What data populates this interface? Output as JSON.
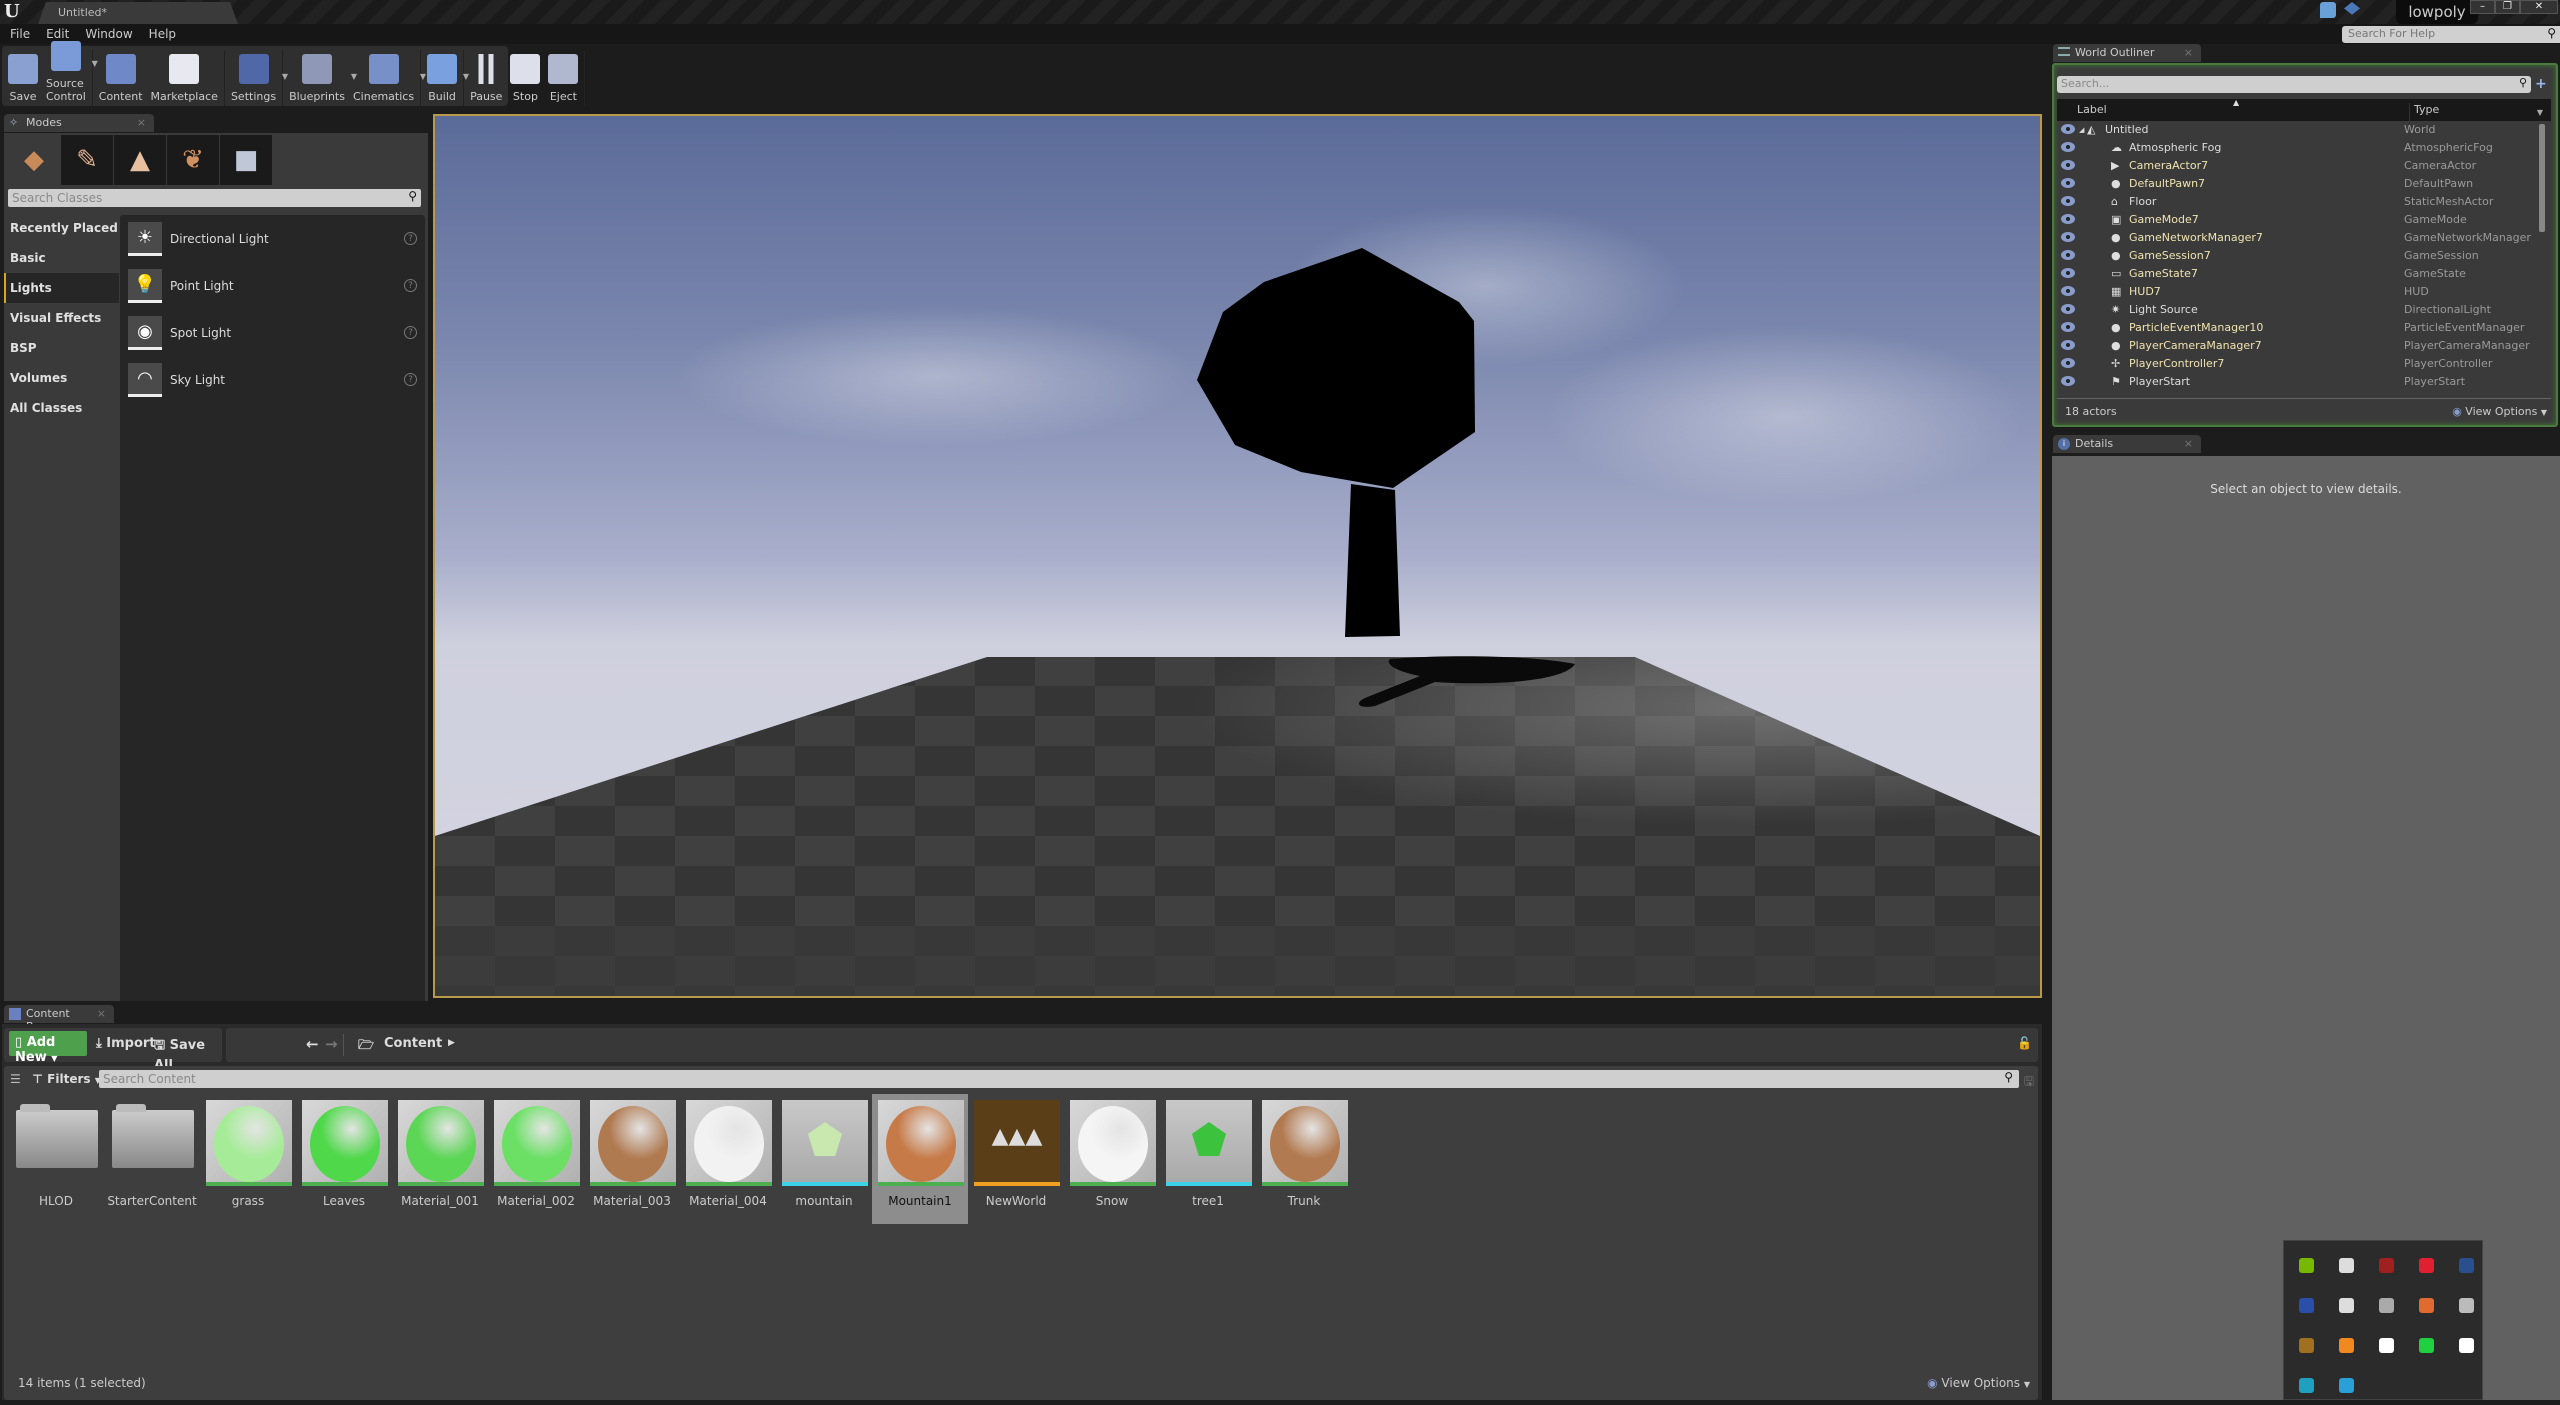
{
  "window": {
    "document_tab": "Untitled*",
    "project_name": "lowpoly",
    "help_search_placeholder": "Search For Help",
    "controls": {
      "minimize": "–",
      "restore": "❐",
      "close": "✕"
    }
  },
  "menu": [
    "File",
    "Edit",
    "Window",
    "Help"
  ],
  "toolbar": {
    "groups": [
      [
        {
          "label": "Save",
          "icon": "save-icon",
          "caret": false
        },
        {
          "label": "Source Control",
          "icon": "source-control-icon",
          "caret": true
        }
      ],
      [
        {
          "label": "Content",
          "icon": "content-icon",
          "caret": false
        },
        {
          "label": "Marketplace",
          "icon": "marketplace-icon",
          "caret": false
        }
      ],
      [
        {
          "label": "Settings",
          "icon": "settings-icon",
          "caret": true
        }
      ],
      [
        {
          "label": "Blueprints",
          "icon": "blueprints-icon",
          "caret": true
        },
        {
          "label": "Cinematics",
          "icon": "cinematics-icon",
          "caret": true
        }
      ],
      [
        {
          "label": "Build",
          "icon": "build-icon",
          "caret": true
        }
      ],
      [
        {
          "label": "Pause",
          "icon": "pause-icon",
          "caret": false
        },
        {
          "label": "Stop",
          "icon": "stop-icon",
          "caret": false
        },
        {
          "label": "Eject",
          "icon": "eject-icon",
          "caret": false
        }
      ]
    ]
  },
  "modes": {
    "tab_title": "Modes",
    "mode_tabs": [
      {
        "name": "place-mode-icon",
        "glyph": "◆",
        "color": "#c98a5a"
      },
      {
        "name": "paint-mode-icon",
        "glyph": "✎",
        "color": "#e0b090"
      },
      {
        "name": "landscape-mode-icon",
        "glyph": "▲",
        "color": "#e8c0a0"
      },
      {
        "name": "foliage-mode-icon",
        "glyph": "❦",
        "color": "#d09060"
      },
      {
        "name": "geometry-mode-icon",
        "glyph": "■",
        "color": "#c0c8d8"
      }
    ],
    "search_placeholder": "Search Classes",
    "categories": [
      "Recently Placed",
      "Basic",
      "Lights",
      "Visual Effects",
      "BSP",
      "Volumes",
      "All Classes"
    ],
    "active_category": "Lights",
    "classes": [
      {
        "label": "Directional Light",
        "icon": "directional-light-icon",
        "glyph": "☀"
      },
      {
        "label": "Point Light",
        "icon": "point-light-icon",
        "glyph": "💡"
      },
      {
        "label": "Spot Light",
        "icon": "spot-light-icon",
        "glyph": "◉"
      },
      {
        "label": "Sky Light",
        "icon": "sky-light-icon",
        "glyph": "◠"
      }
    ],
    "help_glyph": "?"
  },
  "viewport": {
    "sky_top": "#5b6b99",
    "border_color": "#b99a4a"
  },
  "outliner": {
    "tab_title": "World Outliner",
    "search_placeholder": "Search...",
    "col_label": "Label",
    "col_type": "Type",
    "rows": [
      {
        "label": "Untitled",
        "type": "World",
        "level": 0,
        "style": "white",
        "icon": "world-icon",
        "glyph": "◭"
      },
      {
        "label": "Atmospheric Fog",
        "type": "AtmosphericFog",
        "level": 1,
        "style": "white",
        "icon": "fog-icon",
        "glyph": "☁"
      },
      {
        "label": "CameraActor7",
        "type": "CameraActor",
        "level": 1,
        "style": "gold",
        "icon": "camera-icon",
        "glyph": "▶"
      },
      {
        "label": "DefaultPawn7",
        "type": "DefaultPawn",
        "level": 1,
        "style": "gold",
        "icon": "pawn-icon",
        "glyph": "●"
      },
      {
        "label": "Floor",
        "type": "StaticMeshActor",
        "level": 1,
        "style": "white",
        "icon": "static-mesh-icon",
        "glyph": "⌂"
      },
      {
        "label": "GameMode7",
        "type": "GameMode",
        "level": 1,
        "style": "gold",
        "icon": "gamemode-icon",
        "glyph": "▣"
      },
      {
        "label": "GameNetworkManager7",
        "type": "GameNetworkManager",
        "level": 1,
        "style": "gold",
        "icon": "actor-sphere-icon",
        "glyph": "●"
      },
      {
        "label": "GameSession7",
        "type": "GameSession",
        "level": 1,
        "style": "gold",
        "icon": "actor-sphere-icon",
        "glyph": "●"
      },
      {
        "label": "GameState7",
        "type": "GameState",
        "level": 1,
        "style": "gold",
        "icon": "gamestate-icon",
        "glyph": "▭"
      },
      {
        "label": "HUD7",
        "type": "HUD",
        "level": 1,
        "style": "gold",
        "icon": "hud-icon",
        "glyph": "▦"
      },
      {
        "label": "Light Source",
        "type": "DirectionalLight",
        "level": 1,
        "style": "white",
        "icon": "directional-light-icon",
        "glyph": "✷"
      },
      {
        "label": "ParticleEventManager10",
        "type": "ParticleEventManager",
        "level": 1,
        "style": "gold",
        "icon": "actor-sphere-icon",
        "glyph": "●"
      },
      {
        "label": "PlayerCameraManager7",
        "type": "PlayerCameraManager",
        "level": 1,
        "style": "gold",
        "icon": "actor-sphere-icon",
        "glyph": "●"
      },
      {
        "label": "PlayerController7",
        "type": "PlayerController",
        "level": 1,
        "style": "gold",
        "icon": "controller-icon",
        "glyph": "✢"
      },
      {
        "label": "PlayerStart",
        "type": "PlayerStart",
        "level": 1,
        "style": "white",
        "icon": "player-start-icon",
        "glyph": "⚑"
      }
    ],
    "actor_count": "18 actors",
    "view_options": "View Options"
  },
  "details": {
    "tab_title": "Details",
    "empty_message": "Select an object to view details."
  },
  "content_browser": {
    "tab_title": "Content Browser",
    "add_new": "Add New",
    "import": "Import",
    "save_all": "Save All",
    "path": "Content",
    "filters": "Filters",
    "search_placeholder": "Search Content",
    "assets": [
      {
        "name": "HLOD",
        "kind": "folder"
      },
      {
        "name": "StarterContent",
        "kind": "folder"
      },
      {
        "name": "grass",
        "kind": "material",
        "color": "#a6ec98",
        "bar": "#4caf50"
      },
      {
        "name": "Leaves",
        "kind": "material",
        "color": "#4fd84a",
        "bar": "#4caf50"
      },
      {
        "name": "Material_001",
        "kind": "material",
        "color": "#5cd655",
        "bar": "#4caf50"
      },
      {
        "name": "Material_002",
        "kind": "material",
        "color": "#6be065",
        "bar": "#4caf50"
      },
      {
        "name": "Material_003",
        "kind": "material",
        "color": "#b07a50",
        "bar": "#4caf50"
      },
      {
        "name": "Material_004",
        "kind": "material",
        "color": "#f2f2f2",
        "bar": "#4caf50"
      },
      {
        "name": "mountain",
        "kind": "mesh",
        "color": "#c8e8b0",
        "bar": "#3bd3e8"
      },
      {
        "name": "Mountain1",
        "kind": "material",
        "color": "#c67a48",
        "bar": "#4caf50",
        "selected": true
      },
      {
        "name": "NewWorld",
        "kind": "level",
        "color": "#5a3e18",
        "bar": "#f0a020"
      },
      {
        "name": "Snow",
        "kind": "material",
        "color": "#f5f5f5",
        "bar": "#4caf50"
      },
      {
        "name": "tree1",
        "kind": "mesh",
        "color": "#3cc23c",
        "bar": "#3bd3e8"
      },
      {
        "name": "Trunk",
        "kind": "material",
        "color": "#b27a50",
        "bar": "#4caf50"
      }
    ],
    "status": "14 items (1 selected)",
    "view_options": "View Options"
  },
  "tray_popup": {
    "icons": [
      {
        "name": "nvidia-icon",
        "color": "#76b900"
      },
      {
        "name": "satellite-dish-icon",
        "color": "#dddddd"
      },
      {
        "name": "red-sync-icon",
        "color": "#a02020"
      },
      {
        "name": "red-blocked-icon",
        "color": "#e02030"
      },
      {
        "name": "steam-icon",
        "color": "#2a4f8f"
      },
      {
        "name": "blue-yeti-icon",
        "color": "#2a4fa8"
      },
      {
        "name": "three-dots-circle-icon",
        "color": "#dddddd"
      },
      {
        "name": "greenshot-icon",
        "color": "#aaaaaa"
      },
      {
        "name": "origin-icon",
        "color": "#e06a30"
      },
      {
        "name": "epic-games-icon",
        "color": "#bbbbbb"
      },
      {
        "name": "corsair-icon",
        "color": "#a07020"
      },
      {
        "name": "sublime-icon",
        "color": "#f08a20"
      },
      {
        "name": "shield-icon",
        "color": "#ffffff"
      },
      {
        "name": "green-cloud-icon",
        "color": "#20d040"
      },
      {
        "name": "gear-alert-icon",
        "color": "#ffffff"
      },
      {
        "name": "autodesk-icon",
        "color": "#20a0c0"
      },
      {
        "name": "hexagon-ring-icon",
        "color": "#2aa0d8"
      }
    ]
  }
}
